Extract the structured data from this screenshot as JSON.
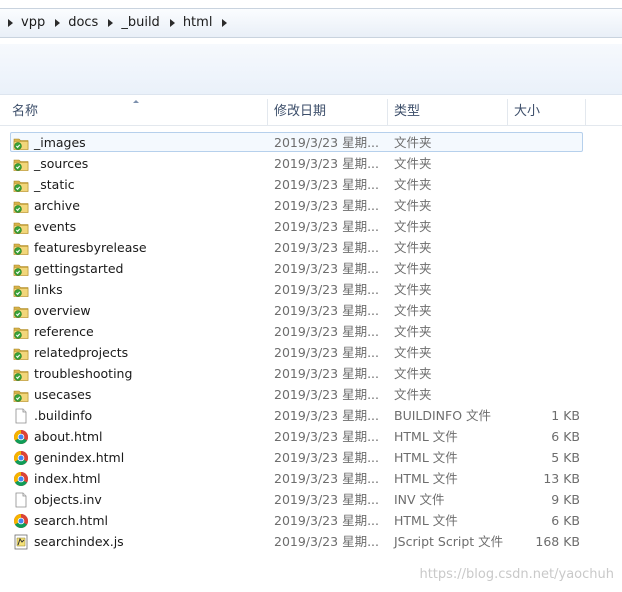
{
  "breadcrumb": [
    "vpp",
    "docs",
    "_build",
    "html"
  ],
  "columns": {
    "name": "名称",
    "date": "修改日期",
    "type": "类型",
    "size": "大小"
  },
  "files": [
    {
      "name": "_images",
      "date": "2019/3/23 星期...",
      "type": "文件夹",
      "size": "",
      "icon": "folder-icon",
      "selected": true
    },
    {
      "name": "_sources",
      "date": "2019/3/23 星期...",
      "type": "文件夹",
      "size": "",
      "icon": "folder-icon"
    },
    {
      "name": "_static",
      "date": "2019/3/23 星期...",
      "type": "文件夹",
      "size": "",
      "icon": "folder-icon"
    },
    {
      "name": "archive",
      "date": "2019/3/23 星期...",
      "type": "文件夹",
      "size": "",
      "icon": "folder-icon"
    },
    {
      "name": "events",
      "date": "2019/3/23 星期...",
      "type": "文件夹",
      "size": "",
      "icon": "folder-icon"
    },
    {
      "name": "featuresbyrelease",
      "date": "2019/3/23 星期...",
      "type": "文件夹",
      "size": "",
      "icon": "folder-icon"
    },
    {
      "name": "gettingstarted",
      "date": "2019/3/23 星期...",
      "type": "文件夹",
      "size": "",
      "icon": "folder-icon"
    },
    {
      "name": "links",
      "date": "2019/3/23 星期...",
      "type": "文件夹",
      "size": "",
      "icon": "folder-icon"
    },
    {
      "name": "overview",
      "date": "2019/3/23 星期...",
      "type": "文件夹",
      "size": "",
      "icon": "folder-icon"
    },
    {
      "name": "reference",
      "date": "2019/3/23 星期...",
      "type": "文件夹",
      "size": "",
      "icon": "folder-icon"
    },
    {
      "name": "relatedprojects",
      "date": "2019/3/23 星期...",
      "type": "文件夹",
      "size": "",
      "icon": "folder-icon"
    },
    {
      "name": "troubleshooting",
      "date": "2019/3/23 星期...",
      "type": "文件夹",
      "size": "",
      "icon": "folder-icon"
    },
    {
      "name": "usecases",
      "date": "2019/3/23 星期...",
      "type": "文件夹",
      "size": "",
      "icon": "folder-icon"
    },
    {
      "name": ".buildinfo",
      "date": "2019/3/23 星期...",
      "type": "BUILDINFO 文件",
      "size": "1 KB",
      "icon": "blank-file-icon"
    },
    {
      "name": "about.html",
      "date": "2019/3/23 星期...",
      "type": "HTML 文件",
      "size": "6 KB",
      "icon": "chrome-html-icon"
    },
    {
      "name": "genindex.html",
      "date": "2019/3/23 星期...",
      "type": "HTML 文件",
      "size": "5 KB",
      "icon": "chrome-html-icon"
    },
    {
      "name": "index.html",
      "date": "2019/3/23 星期...",
      "type": "HTML 文件",
      "size": "13 KB",
      "icon": "chrome-html-icon"
    },
    {
      "name": "objects.inv",
      "date": "2019/3/23 星期...",
      "type": "INV 文件",
      "size": "9 KB",
      "icon": "blank-file-icon"
    },
    {
      "name": "search.html",
      "date": "2019/3/23 星期...",
      "type": "HTML 文件",
      "size": "6 KB",
      "icon": "chrome-html-icon"
    },
    {
      "name": "searchindex.js",
      "date": "2019/3/23 星期...",
      "type": "JScript Script 文件",
      "size": "168 KB",
      "icon": "jscript-file-icon"
    }
  ],
  "watermark": "https://blog.csdn.net/yaochuh",
  "colors": {
    "selection_border": "#b6d0ec",
    "selection_fill": "#f4f9fe",
    "header_text": "#3c4e6a",
    "meta_text": "#6d6d6d"
  }
}
